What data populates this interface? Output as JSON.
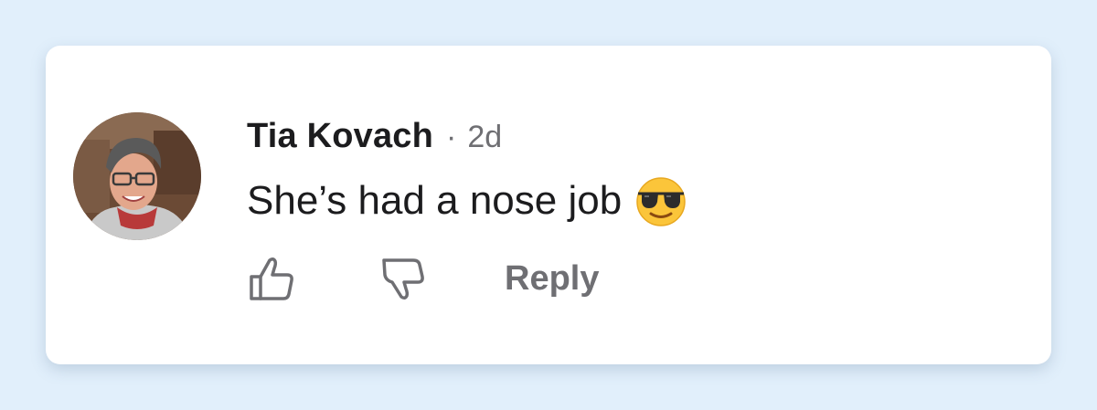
{
  "comment": {
    "author": "Tia Kovach",
    "separator": "·",
    "time_ago": "2d",
    "text": "She’s had a nose job",
    "emoji": "smiling-face-with-sunglasses"
  },
  "actions": {
    "like_icon": "thumbs-up-icon",
    "dislike_icon": "thumbs-down-icon",
    "reply_label": "Reply"
  },
  "colors": {
    "page_background": "#e1effb",
    "card_background": "#ffffff",
    "primary_text": "#1c1c1e",
    "secondary_text": "#6f6f73"
  }
}
